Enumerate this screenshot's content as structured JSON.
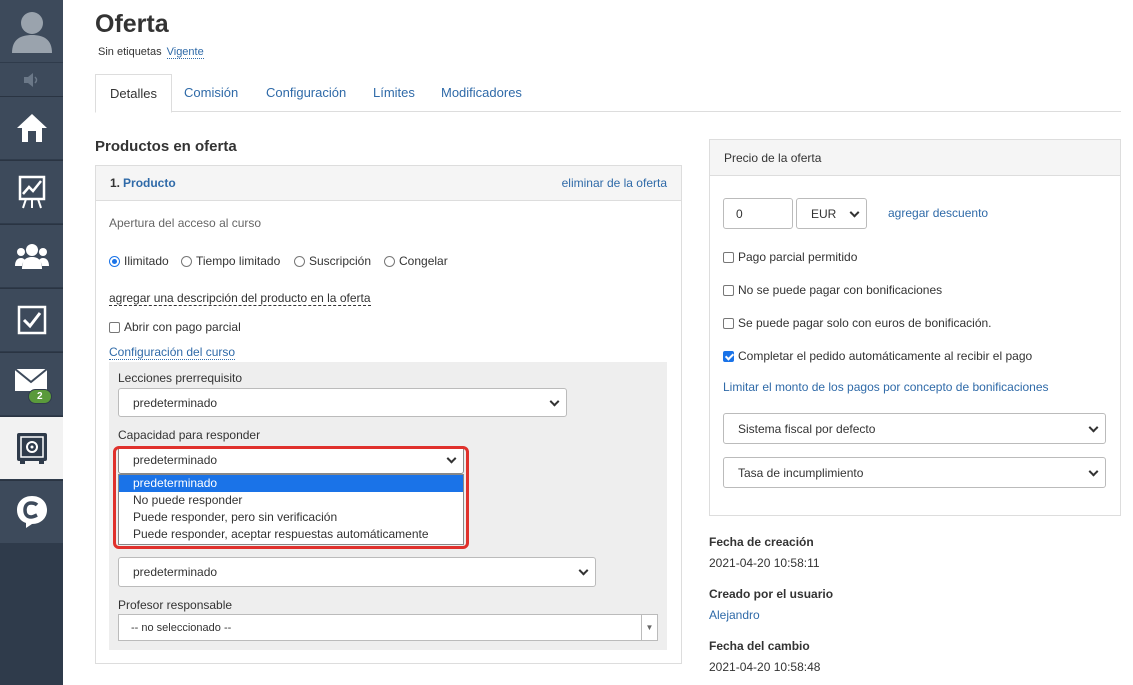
{
  "page": {
    "title": "Oferta",
    "tags_label": "Sin etiquetas",
    "status_link": "Vigente"
  },
  "tabs": [
    "Detalles",
    "Comisión",
    "Configuración",
    "Límites",
    "Modificadores"
  ],
  "sidebar": {
    "mail_badge": "2"
  },
  "products": {
    "heading": "Productos en oferta",
    "item_number": "1.",
    "item_name": "Producto",
    "remove_link": "eliminar de la oferta",
    "access_label": "Apertura del acceso al curso",
    "radios": [
      "Ilimitado",
      "Tiempo limitado",
      "Suscripción",
      "Congelar"
    ],
    "add_description": "agregar una descripción del producto en la oferta",
    "partial_payment": "Abrir con pago parcial",
    "course_settings": "Configuración del curso",
    "prereq_label": "Lecciones prerrequisito",
    "prereq_value": "predeterminado",
    "answer_label": "Capacidad para responder",
    "answer_value": "predeterminado",
    "answer_options": [
      "predeterminado",
      "No puede responder",
      "Puede responder, pero sin verificación",
      "Puede responder, aceptar respuestas automáticamente"
    ],
    "access_lessons_value": "predeterminado",
    "teacher_label": "Profesor responsable",
    "teacher_value": "-- no seleccionado --"
  },
  "price": {
    "heading": "Precio de la oferta",
    "amount": "0",
    "currency": "EUR",
    "add_discount": "agregar descuento",
    "checkboxes": [
      {
        "label": "Pago parcial permitido",
        "checked": false
      },
      {
        "label": "No se puede pagar con bonificaciones",
        "checked": false
      },
      {
        "label": "Se puede pagar solo con euros de bonificación.",
        "checked": false
      },
      {
        "label": "Completar el pedido automáticamente al recibir el pago",
        "checked": true
      }
    ],
    "limit_link": "Limitar el monto de los pagos por concepto de bonificaciones",
    "tax_system": "Sistema fiscal por defecto",
    "tax_rate": "Tasa de incumplimiento"
  },
  "meta": {
    "created_label": "Fecha de creación",
    "created_value": "2021-04-20 10:58:11",
    "created_by_label": "Creado por el usuario",
    "created_by_value": "Alejandro",
    "changed_label": "Fecha del cambio",
    "changed_value": "2021-04-20 10:58:48"
  },
  "colors": {
    "sidebar": "#2f3b4b",
    "link": "#2f6aa8",
    "highlight": "#e0312c",
    "selected": "#1a73e8"
  }
}
